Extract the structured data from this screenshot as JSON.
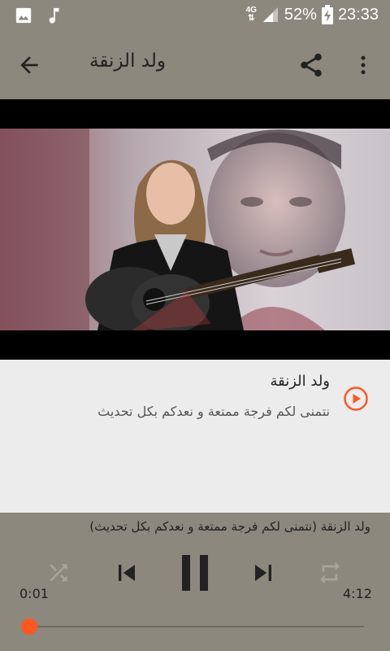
{
  "status_bar": {
    "network": "4G",
    "battery": "52%",
    "time": "23:33",
    "icons": [
      "image-icon",
      "music-note-icon",
      "signal-icon",
      "battery-charging-icon"
    ]
  },
  "app_bar": {
    "title": "ولد الزنقة",
    "icons": [
      "back-arrow-icon",
      "share-icon",
      "more-vert-icon"
    ]
  },
  "song": {
    "title": "ولد الزنقة",
    "subtitle": "نتمنى لكم فرجة ممتعة و نعدكم بكل تحديث",
    "icon": "play-circle-icon"
  },
  "player": {
    "now_playing": "ولد الزنقة (نتمنى لكم فرجة ممتعة و نعدكم بكل تحديث)",
    "elapsed": "0:01",
    "duration": "4:12",
    "progress_fraction": 0.004,
    "controls": [
      "shuffle-icon",
      "previous-icon",
      "pause-icon",
      "next-icon",
      "repeat-icon"
    ]
  },
  "colors": {
    "bar": "#8c887e",
    "accent": "#ff5722",
    "background": "#ececec"
  }
}
